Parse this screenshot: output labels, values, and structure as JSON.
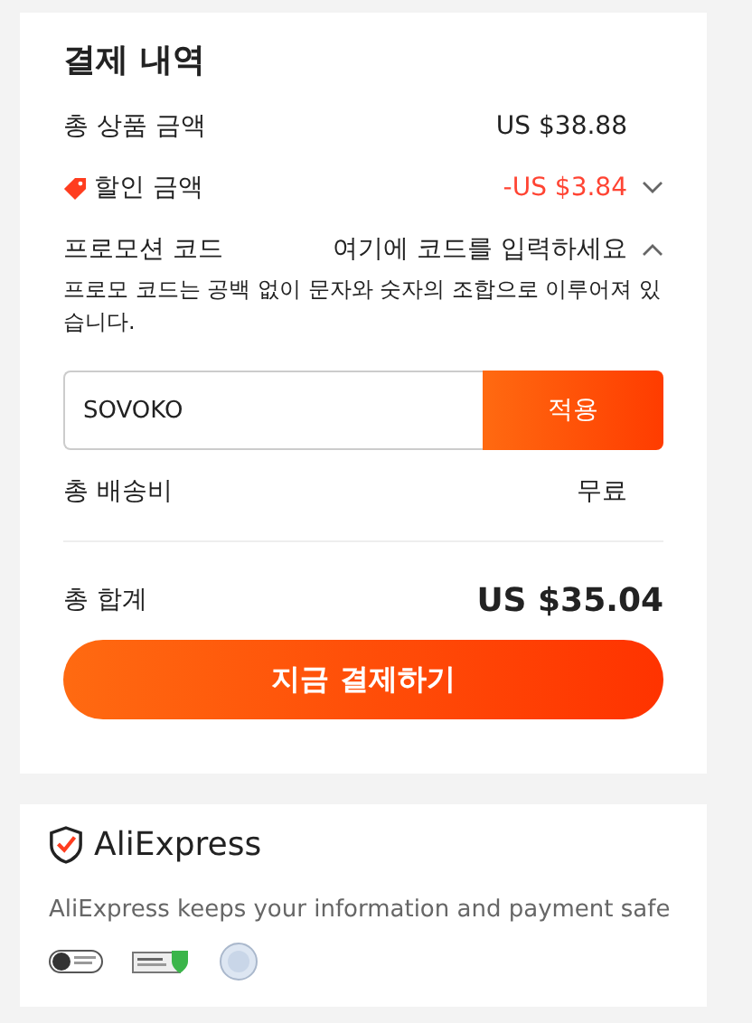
{
  "title": "결제 내역",
  "rows": [
    {
      "kind": "item",
      "label": "총 상품 금액",
      "value": "US $38.88"
    },
    {
      "kind": "discount",
      "label": "할인 금액",
      "value": "-US $3.84",
      "expanded": false
    }
  ],
  "promo": {
    "label": "프로모션 코드",
    "prompt": "여기에 코드를 입력하세요",
    "expanded": true,
    "hint": "프로모 코드는 공백 없이 문자와 숫자의 조합으로 이루어져 있습니다.",
    "input": {
      "value": "SOVOKO"
    },
    "apply": "적용"
  },
  "shipping": {
    "label": "총 배송비",
    "value": "무료"
  },
  "total": {
    "label": "총 합계",
    "value": "US $35.04"
  },
  "pay_button": "지금 결제하기",
  "security": {
    "logo": "AliExpress",
    "text": "AliExpress keeps your information and payment safe"
  }
}
